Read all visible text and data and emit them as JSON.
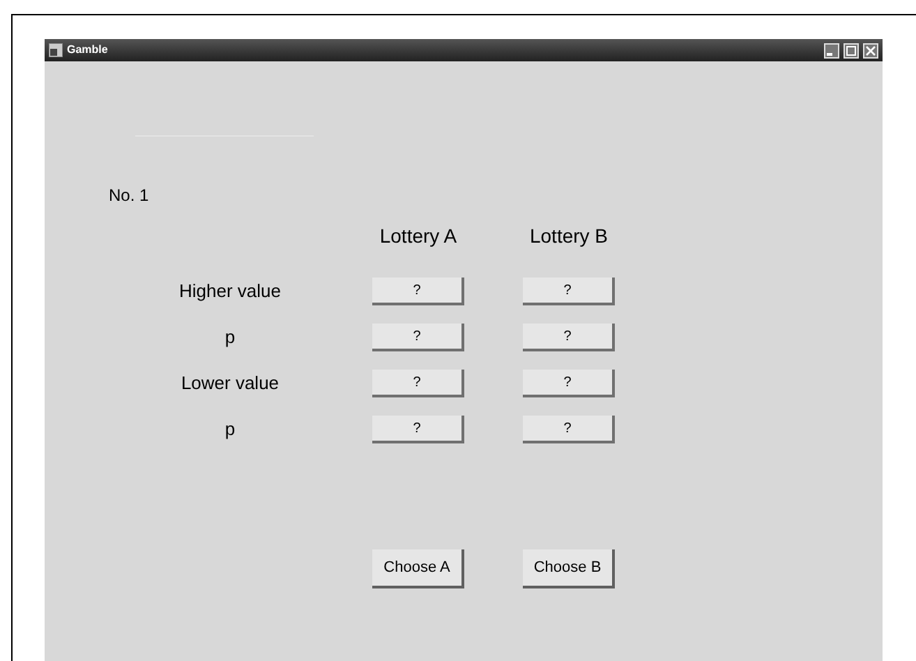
{
  "window": {
    "title": "Gamble"
  },
  "trial_label": "No. 1",
  "columns": [
    "Lottery A",
    "Lottery B"
  ],
  "rows": [
    {
      "label": "Higher value",
      "cells": [
        "?",
        "?"
      ]
    },
    {
      "label": "p",
      "cells": [
        "?",
        "?"
      ]
    },
    {
      "label": "Lower value",
      "cells": [
        "?",
        "?"
      ]
    },
    {
      "label": "p",
      "cells": [
        "?",
        "?"
      ]
    }
  ],
  "buttons": [
    "Choose A",
    "Choose B"
  ]
}
